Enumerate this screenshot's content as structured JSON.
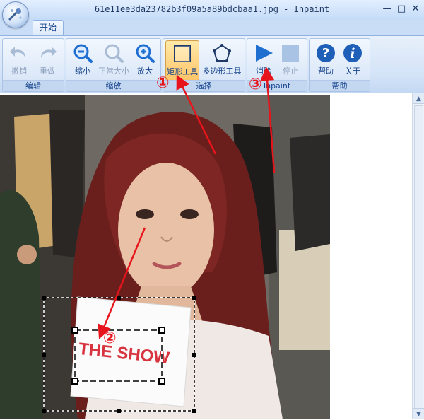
{
  "window": {
    "title": "61e11ee3da23782b3f09a5a89bdcbaa1.jpg - Inpaint",
    "min_glyph": "—",
    "max_glyph": "□",
    "close_glyph": "✕"
  },
  "ribbon": {
    "tabs": [
      {
        "label": "开始"
      }
    ],
    "groups": {
      "edit": {
        "label": "编辑",
        "undo": "撤销",
        "redo": "重做"
      },
      "zoom": {
        "label": "缩放",
        "zoom_out": "缩小",
        "actual_size": "正常大小",
        "zoom_in": "放大"
      },
      "select": {
        "label": "选择",
        "rect_tool": "矩形工具",
        "poly_tool": "多边形工具"
      },
      "inpaint": {
        "label": "Inpaint",
        "erase": "消除",
        "stop": "停止"
      },
      "help": {
        "label": "帮助",
        "help": "帮助",
        "about": "关于"
      }
    }
  },
  "annotations": {
    "step1": "①",
    "step2": "②",
    "step3": "③",
    "color": "#e8141c"
  },
  "photo": {
    "card_text": "THE SHOW"
  },
  "colors": {
    "ribbon_bg": "#d3e3f7",
    "accent_text": "#15428b",
    "active_tool": "#ffc56a",
    "icon_blue": "#1f6fd1"
  }
}
